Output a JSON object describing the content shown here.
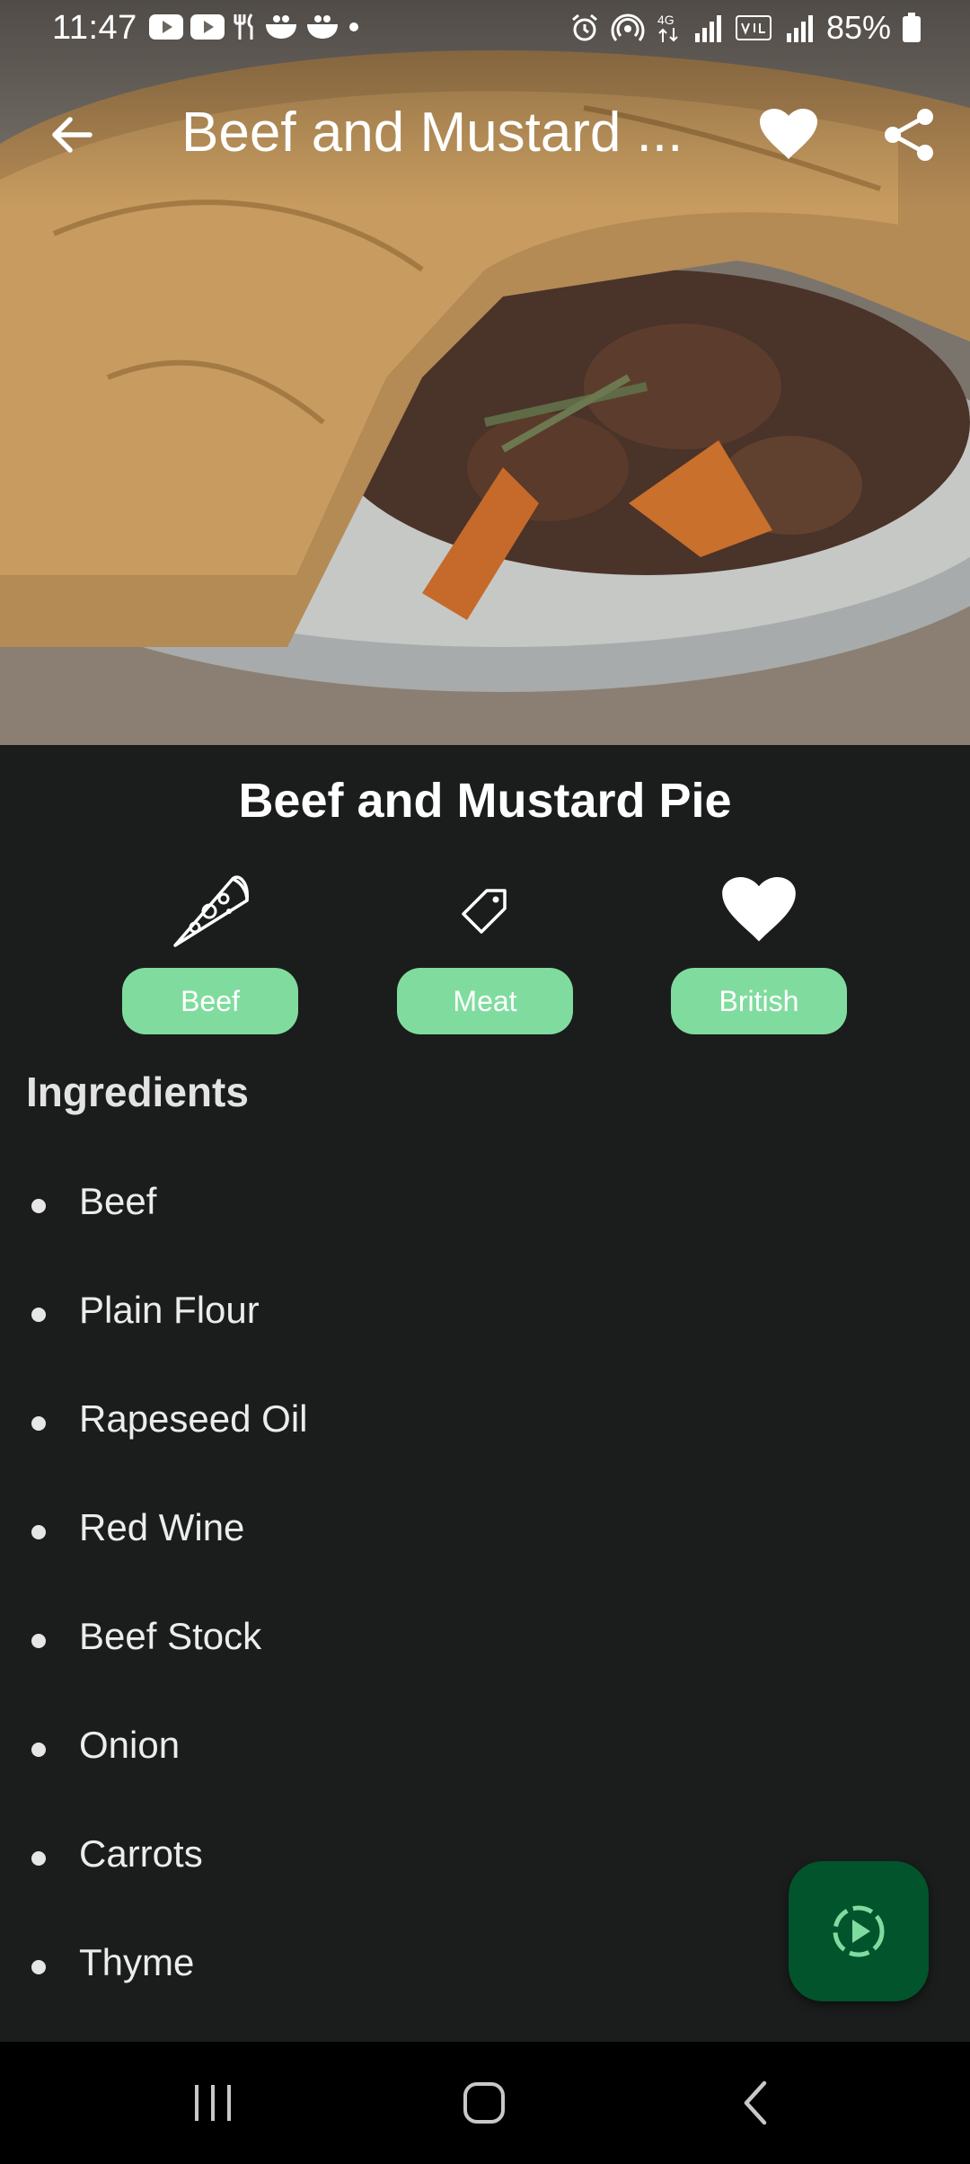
{
  "status_bar": {
    "time": "11:47",
    "battery": "85%",
    "network": "4G"
  },
  "app_bar": {
    "title": "Beef and Mustard ...",
    "back_icon": "arrow-back-icon",
    "favorite_icon": "heart-icon",
    "share_icon": "share-icon"
  },
  "recipe": {
    "title": "Beef and Mustard Pie",
    "tags": [
      {
        "icon": "pizza-icon",
        "label": "Beef"
      },
      {
        "icon": "tag-icon",
        "label": "Meat"
      },
      {
        "icon": "heart-icon",
        "label": "British"
      }
    ]
  },
  "ingredients": {
    "heading": "Ingredients",
    "items": [
      "Beef",
      "Plain Flour",
      "Rapeseed Oil",
      "Red Wine",
      "Beef Stock",
      "Onion",
      "Carrots",
      "Thyme"
    ]
  },
  "fab": {
    "icon": "play-video-icon"
  },
  "colors": {
    "background": "#1b1d1d",
    "chip": "#80dc9e",
    "fab": "#02542d",
    "fab_icon": "#80dc9e"
  }
}
